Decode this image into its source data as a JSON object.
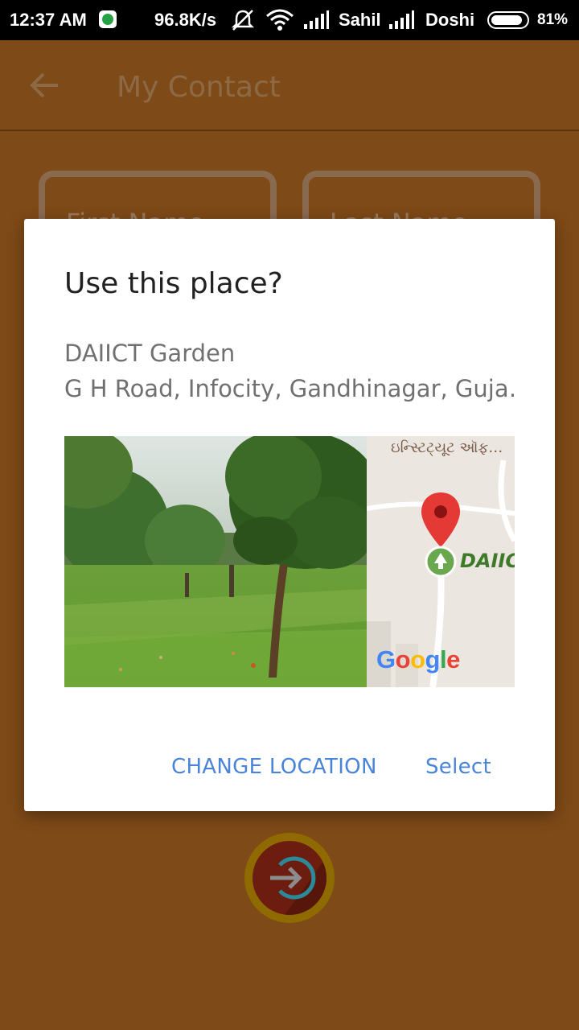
{
  "status_bar": {
    "time": "12:37 AM",
    "speed": "96.8K/s",
    "carrier1": "Sahil",
    "carrier2": "Doshi",
    "battery": "81%"
  },
  "app_bar": {
    "title": "My Contact"
  },
  "form": {
    "first_name_placeholder": "First Name",
    "last_name_placeholder": "Last Name"
  },
  "dialog": {
    "title": "Use this place?",
    "place_name": "DAIICT Garden",
    "place_address": "G H Road, Infocity, Gandhinagar, Guja…",
    "map_label_gujarati": "ઇન્સ્ટિટ્યૂટ ઑફ…",
    "map_place_label": "DAIIC",
    "change_location_label": "CHANGE LOCATION",
    "select_label": "Select"
  },
  "google_logo": [
    "G",
    "o",
    "o",
    "g",
    "l",
    "e"
  ],
  "colors": {
    "app_background": "#7e4a17",
    "dialog_button": "#4a84d8",
    "map_pin": "#e53935",
    "place_icon": "#6aa84f"
  }
}
